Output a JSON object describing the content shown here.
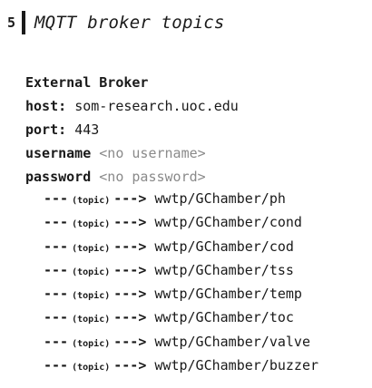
{
  "section": {
    "number": "5",
    "title": "MQTT broker topics"
  },
  "broker": {
    "heading": "External Broker",
    "host_label": "host:",
    "host_value": "som-research.uoc.edu",
    "port_label": "port:",
    "port_value": "443",
    "username_label": "username",
    "username_value": "<no username>",
    "password_label": "password",
    "password_value": "<no password>"
  },
  "topics": {
    "arrow_left": "---",
    "tag": "(topic)",
    "arrow_right": "--->",
    "items": [
      "wwtp/GChamber/ph",
      "wwtp/GChamber/cond",
      "wwtp/GChamber/cod",
      "wwtp/GChamber/tss",
      "wwtp/GChamber/temp",
      "wwtp/GChamber/toc",
      "wwtp/GChamber/valve",
      "wwtp/GChamber/buzzer"
    ]
  }
}
